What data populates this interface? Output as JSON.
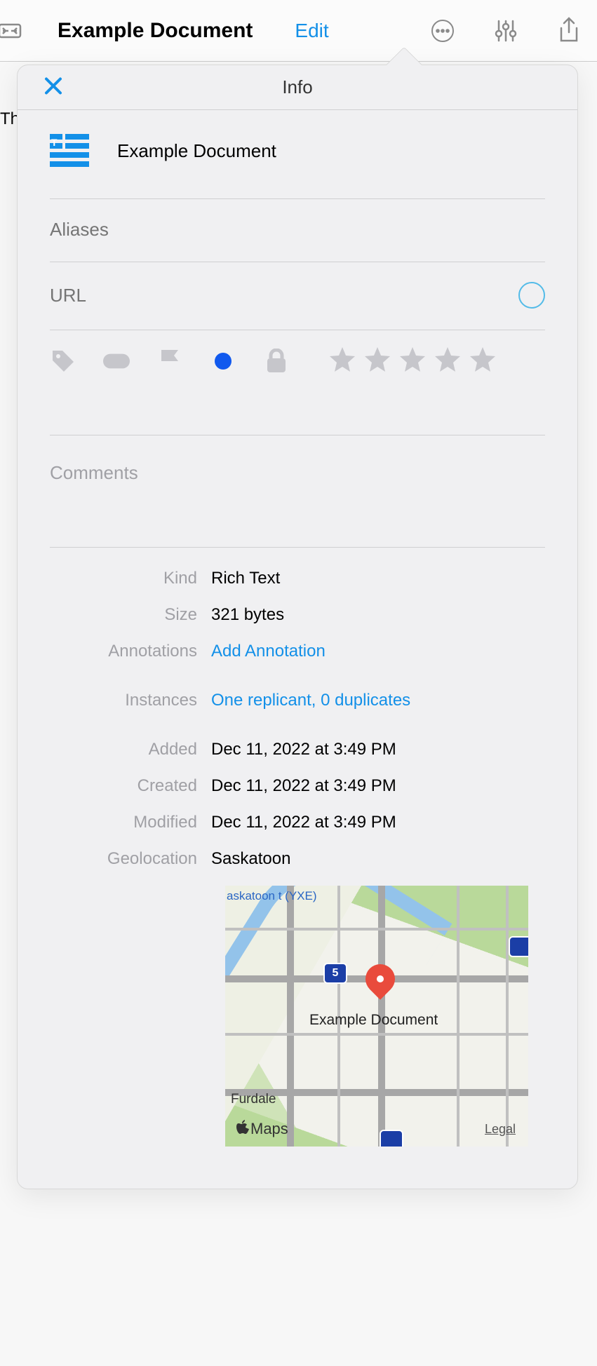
{
  "toolbar": {
    "title": "Example Document",
    "edit": "Edit"
  },
  "bg_text": "Th",
  "popover": {
    "title": "Info",
    "doc_title": "Example Document",
    "aliases_placeholder": "Aliases",
    "url_placeholder": "URL",
    "comments_placeholder": "Comments"
  },
  "meta": {
    "kind_label": "Kind",
    "kind": "Rich Text",
    "size_label": "Size",
    "size": "321 bytes",
    "annotations_label": "Annotations",
    "annotations": "Add Annotation",
    "instances_label": "Instances",
    "instances": "One replicant, 0 duplicates",
    "added_label": "Added",
    "added": "Dec 11, 2022 at 3:49 PM",
    "created_label": "Created",
    "created": "Dec 11, 2022 at 3:49 PM",
    "modified_label": "Modified",
    "modified": "Dec 11, 2022 at 3:49 PM",
    "geo_label": "Geolocation",
    "geo": "Saskatoon"
  },
  "map": {
    "airport": "askatoon\nt (YXE)",
    "hwy": "5",
    "pin_label": "Example Document",
    "furdale": "Furdale",
    "brand": "Maps",
    "legal": "Legal"
  }
}
